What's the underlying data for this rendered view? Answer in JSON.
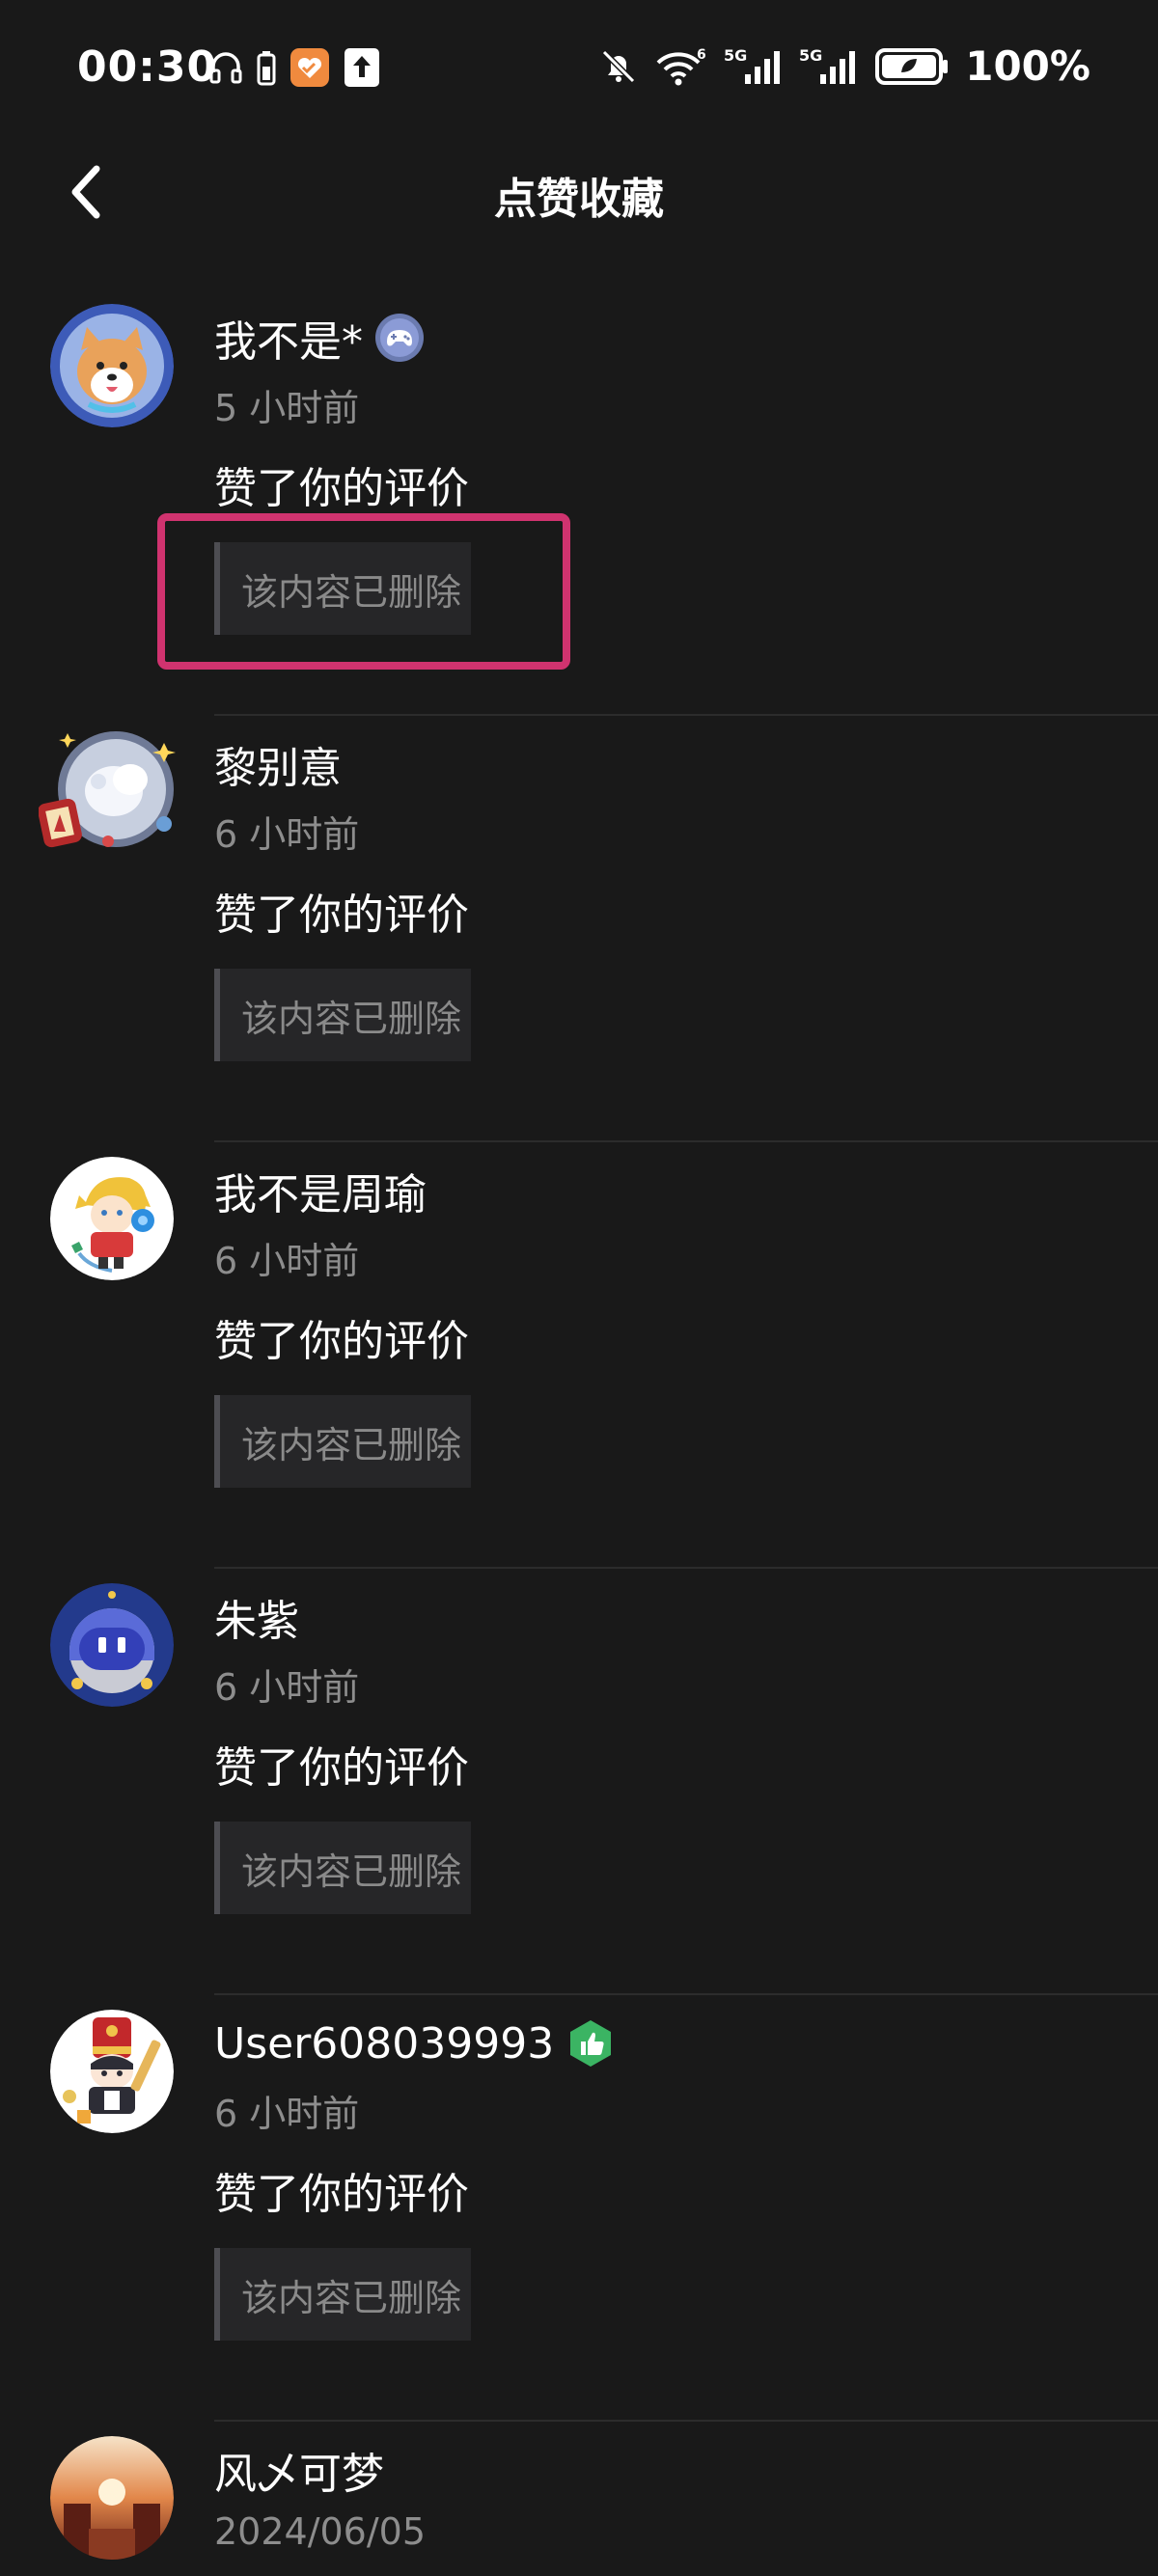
{
  "status_bar": {
    "time": "00:30",
    "battery_text": "100%",
    "icons_left": [
      "headphones-icon",
      "battery-small-icon",
      "app-heart-icon",
      "upload-icon"
    ],
    "icons_right": [
      "bell-mute-icon",
      "wifi-6-icon",
      "signal-5g-1-icon",
      "signal-5g-2-icon",
      "battery-leaf-icon"
    ]
  },
  "header": {
    "title": "点赞收藏",
    "back_icon": "chevron-left-icon"
  },
  "colors": {
    "background": "#191919",
    "highlight_border": "#d0336f",
    "secondary_text": "#8d8d8d",
    "deleted_box": "#262628"
  },
  "items": [
    {
      "name": "我不是*",
      "badge": "game-controller-badge",
      "time": "5 小时前",
      "action": "赞了你的评价",
      "content": "该内容已删除",
      "highlighted": true
    },
    {
      "name": "黎别意",
      "badge": "",
      "time": "6 小时前",
      "action": "赞了你的评价",
      "content": "该内容已删除"
    },
    {
      "name": "我不是周瑜",
      "badge": "",
      "time": "6 小时前",
      "action": "赞了你的评价",
      "content": "该内容已删除"
    },
    {
      "name": "朱紫",
      "badge": "",
      "time": "6 小时前",
      "action": "赞了你的评价",
      "content": "该内容已删除"
    },
    {
      "name": "User608039993",
      "badge": "thumbs-up-badge",
      "time": "6 小时前",
      "action": "赞了你的评价",
      "content": "该内容已删除"
    },
    {
      "name": "风乄可梦",
      "badge": "",
      "time": "2024/06/05"
    }
  ]
}
